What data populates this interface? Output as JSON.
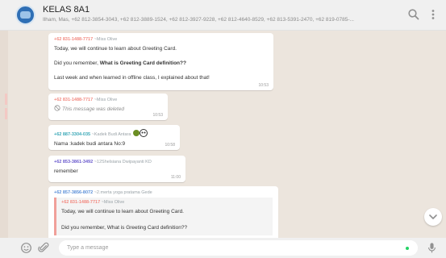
{
  "header": {
    "title": "KELAS 8A1",
    "subtitle": "Ilham, Mas, +62 812-3854-3043, +62 812-3889-1524, +62 812-3927-9228, +62 812-4640-8529, +62 813-5391-2470, +62 819-0785-..."
  },
  "messages": [
    {
      "sender_number": "+62 831-1488-7717",
      "sender_name": "~Miss Olive",
      "lines": [
        "Today, we will continue to learn about Greeting Card.",
        "Did you remember, ",
        "What is Greeting Card definition??",
        "Last week and when learned in offline class, I explained about that!"
      ],
      "time": "10:53"
    },
    {
      "sender_number": "+62 831-1488-7717",
      "sender_name": "~Miss Olive",
      "deleted_text": "This message was deleted",
      "time": "10:53"
    },
    {
      "sender_number": "+62 887-3304-035",
      "sender_name": "~Kadek Budi Antara",
      "text": "Nama :kadek budi antara No:9",
      "time": "10:58"
    },
    {
      "sender_number": "+62 853-3861-3492",
      "sender_name": "~12Shelsiana Dwipayanti KD",
      "text": "remember",
      "time": "11:00"
    },
    {
      "sender_number": "+62 857-3856-8072",
      "sender_name": "~2.merta yoga pratama Gede",
      "quote_sender_number": "+62 831-1488-7717",
      "quote_sender_name": "~Miss Olive",
      "quote_line1": "Today, we will continue to learn about Greeting Card.",
      "quote_line2": "Did you remember, What is Greeting Card definition??"
    }
  ],
  "footer": {
    "placeholder": "Type a message"
  },
  "colors": {
    "sender_red": "#f28b82",
    "sender_purple": "#6a5acd",
    "sender_teal": "#3aa8b7",
    "sender_blue": "#5a8fd8",
    "icon_gray": "#919191"
  }
}
